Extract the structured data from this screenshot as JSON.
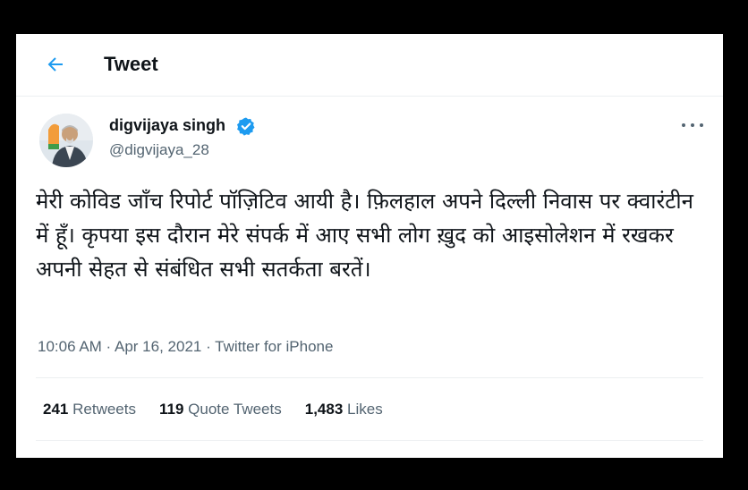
{
  "header": {
    "title": "Tweet",
    "back_icon": "arrow-left-icon",
    "accent_color": "#1d9bf0"
  },
  "author": {
    "name": "digvijaya singh",
    "handle": "@digvijaya_28",
    "verified_icon": "verified-badge-icon",
    "avatar_icon": "user-avatar-photo"
  },
  "menu": {
    "icon": "more-horizontal-icon"
  },
  "tweet": {
    "text": "मेरी कोविड जाँच रिपोर्ट पॉज़िटिव आयी है। फ़िलहाल अपने दिल्ली निवास पर क्वारंटीन में हूँ। कृपया इस दौरान मेरे संपर्क में आए सभी लोग ख़ुद को आइसोलेशन में रखकर अपनी सेहत से संबंधित सभी सतर्कता बरतें।",
    "time": "10:06 AM",
    "date": "Apr 16, 2021",
    "source": "Twitter for iPhone",
    "separator": " · "
  },
  "stats": {
    "retweets_count": "241",
    "retweets_label": "Retweets",
    "quotes_count": "119",
    "quotes_label": "Quote Tweets",
    "likes_count": "1,483",
    "likes_label": "Likes"
  }
}
